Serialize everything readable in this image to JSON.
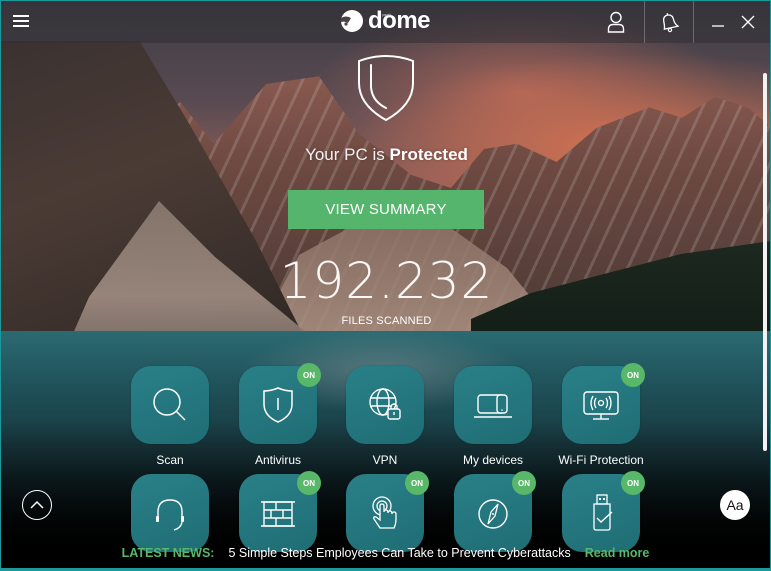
{
  "app": {
    "brand_small": "panda",
    "brand": "dome"
  },
  "header": {
    "menu_icon": "hamburger-icon",
    "user_icon": "user-icon",
    "notifications_icon": "bell-icon",
    "minimize_icon": "minimize-icon",
    "close_icon": "close-icon"
  },
  "status": {
    "prefix": "Your PC is ",
    "state": "Protected",
    "summary_button": "VIEW SUMMARY",
    "files_count": "192.232",
    "files_label": "FILES SCANNED"
  },
  "features": [
    {
      "label": "Scan",
      "icon": "search-icon",
      "on": false,
      "badge": ""
    },
    {
      "label": "Antivirus",
      "icon": "shield-icon",
      "on": true,
      "badge": "ON"
    },
    {
      "label": "VPN",
      "icon": "globe-lock-icon",
      "on": false,
      "badge": ""
    },
    {
      "label": "My devices",
      "icon": "devices-icon",
      "on": false,
      "badge": ""
    },
    {
      "label": "Wi-Fi Protection",
      "icon": "wifi-monitor-icon",
      "on": true,
      "badge": "ON"
    },
    {
      "label": "",
      "icon": "headset-icon",
      "on": false,
      "badge": ""
    },
    {
      "label": "",
      "icon": "firewall-icon",
      "on": true,
      "badge": "ON"
    },
    {
      "label": "",
      "icon": "touch-icon",
      "on": true,
      "badge": "ON"
    },
    {
      "label": "",
      "icon": "compass-icon",
      "on": true,
      "badge": "ON"
    },
    {
      "label": "",
      "icon": "usb-check-icon",
      "on": true,
      "badge": "ON"
    }
  ],
  "controls": {
    "scroll_up_icon": "chevron-up-icon",
    "font_size_label": "Aa"
  },
  "news": {
    "label": "LATEST NEWS:",
    "title": "5 Simple Steps Employees Can Take to Prevent Cyberattacks",
    "link": "Read more"
  },
  "colors": {
    "accent_green": "#55b56c",
    "tile_teal": "#23767e",
    "window_border": "#1a9a9a"
  }
}
